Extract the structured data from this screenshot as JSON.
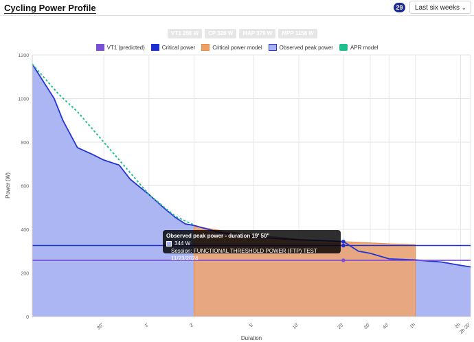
{
  "header": {
    "title": "Cycling Power Profile",
    "badge": "29",
    "period_select": "Last six weeks"
  },
  "metrics": [
    "VT1 258 W",
    "CP 326 W",
    "MAP 379 W",
    "MPP 1158 W"
  ],
  "legend": [
    {
      "label": "VT1 (predicted)",
      "color": "#7b4fd6",
      "kind": "line"
    },
    {
      "label": "Critical power",
      "color": "#1e2fd1",
      "kind": "line"
    },
    {
      "label": "Critical power model",
      "color": "#f0a066",
      "kind": "area"
    },
    {
      "label": "Observed peak power",
      "color": "#a8b2f2",
      "kind": "area"
    },
    {
      "label": "APR model",
      "color": "#1fbf8f",
      "kind": "dashed"
    }
  ],
  "tooltip": {
    "title": "Observed peak power - duration 19' 50\"",
    "value": "344 W",
    "session": "Session: FUNCTIONAL THRESHOLD POWER (FTP) TEST 11/23/2024"
  },
  "chart_data": {
    "type": "area",
    "xlabel": "Duration",
    "ylabel": "Power (W)",
    "x_scale": "log",
    "x_unit": "seconds",
    "x_ticks": [
      {
        "value": 30,
        "label": "30\""
      },
      {
        "value": 60,
        "label": "1'"
      },
      {
        "value": 120,
        "label": "2'"
      },
      {
        "value": 300,
        "label": "5'"
      },
      {
        "value": 600,
        "label": "10'"
      },
      {
        "value": 1200,
        "label": "20'"
      },
      {
        "value": 1800,
        "label": "30'"
      },
      {
        "value": 2400,
        "label": "40'"
      },
      {
        "value": 3600,
        "label": "1h"
      },
      {
        "value": 7200,
        "label": "2h"
      },
      {
        "value": 8400,
        "label": "2h 20'"
      }
    ],
    "y_ticks": [
      0,
      200,
      400,
      600,
      800,
      1000,
      1200
    ],
    "ylim": [
      0,
      1200
    ],
    "xlim": [
      10,
      8400
    ],
    "grid": true,
    "legend_position": "top",
    "series": [
      {
        "name": "Observed peak power",
        "x": [
          10,
          14,
          16,
          20,
          25,
          30,
          38,
          45,
          60,
          75,
          90,
          105,
          120,
          180,
          300,
          600,
          900,
          1190,
          1500,
          1800,
          2400,
          3600,
          5400,
          7200,
          8400
        ],
        "values": [
          1158,
          1000,
          900,
          775,
          745,
          718,
          695,
          630,
          560,
          500,
          455,
          425,
          418,
          385,
          365,
          352,
          348,
          344,
          300,
          290,
          265,
          260,
          250,
          235,
          228
        ]
      },
      {
        "name": "APR model",
        "x": [
          10,
          15,
          20,
          30,
          45,
          60,
          90,
          120
        ],
        "values": [
          1158,
          1020,
          940,
          800,
          660,
          560,
          460,
          420
        ]
      },
      {
        "name": "Critical power model",
        "x": [
          120,
          180,
          300,
          600,
          1200,
          1800,
          2400,
          3600
        ],
        "values": [
          415,
          395,
          375,
          355,
          344,
          338,
          334,
          330
        ]
      },
      {
        "name": "Critical power",
        "constant": 326
      },
      {
        "name": "VT1 (predicted)",
        "constant": 258
      }
    ]
  }
}
